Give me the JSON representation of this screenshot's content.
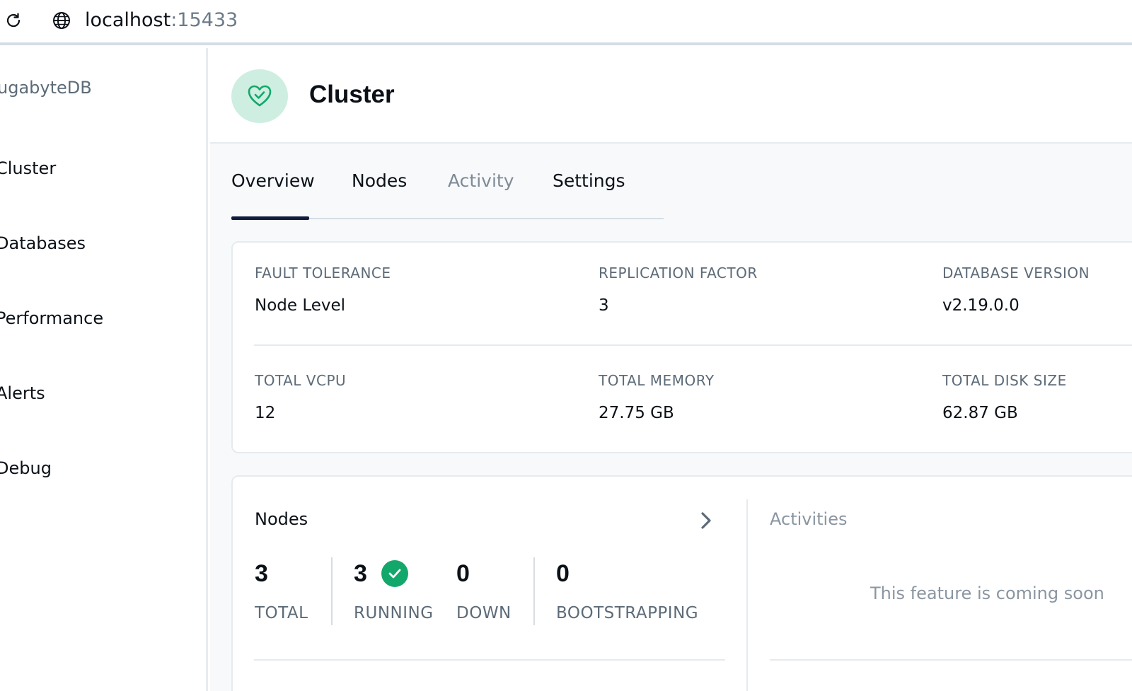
{
  "browser": {
    "url_host": "localhost",
    "url_port": ":15433"
  },
  "sidebar": {
    "brand": "ugabyteDB",
    "items": [
      {
        "label": "Cluster"
      },
      {
        "label": "Databases"
      },
      {
        "label": "Performance"
      },
      {
        "label": "Alerts"
      },
      {
        "label": "Debug"
      }
    ]
  },
  "header": {
    "title": "Cluster",
    "icon": "heart-check-icon"
  },
  "tabs": [
    {
      "label": "Overview",
      "active": true
    },
    {
      "label": "Nodes"
    },
    {
      "label": "Activity",
      "muted": true
    },
    {
      "label": "Settings"
    }
  ],
  "overview": {
    "fault_tolerance": {
      "label": "FAULT TOLERANCE",
      "value": "Node Level"
    },
    "replication_factor": {
      "label": "REPLICATION FACTOR",
      "value": "3"
    },
    "database_version": {
      "label": "DATABASE VERSION",
      "value": "v2.19.0.0"
    },
    "total_vcpu": {
      "label": "TOTAL VCPU",
      "value": "12"
    },
    "total_memory": {
      "label": "TOTAL MEMORY",
      "value": "27.75 GB"
    },
    "total_disk": {
      "label": "TOTAL DISK SIZE",
      "value": "62.87 GB"
    }
  },
  "nodes_panel": {
    "title": "Nodes",
    "total": {
      "value": "3",
      "label": "TOTAL"
    },
    "running": {
      "value": "3",
      "label": "RUNNING"
    },
    "down": {
      "value": "0",
      "label": "DOWN"
    },
    "bootstrapping": {
      "value": "0",
      "label": "BOOTSTRAPPING"
    }
  },
  "activities_panel": {
    "title": "Activities",
    "message": "This feature is coming soon"
  },
  "colors": {
    "accent_green": "#13a86b",
    "tab_indicator": "#101b3d",
    "muted_text": "#5d6b78"
  }
}
